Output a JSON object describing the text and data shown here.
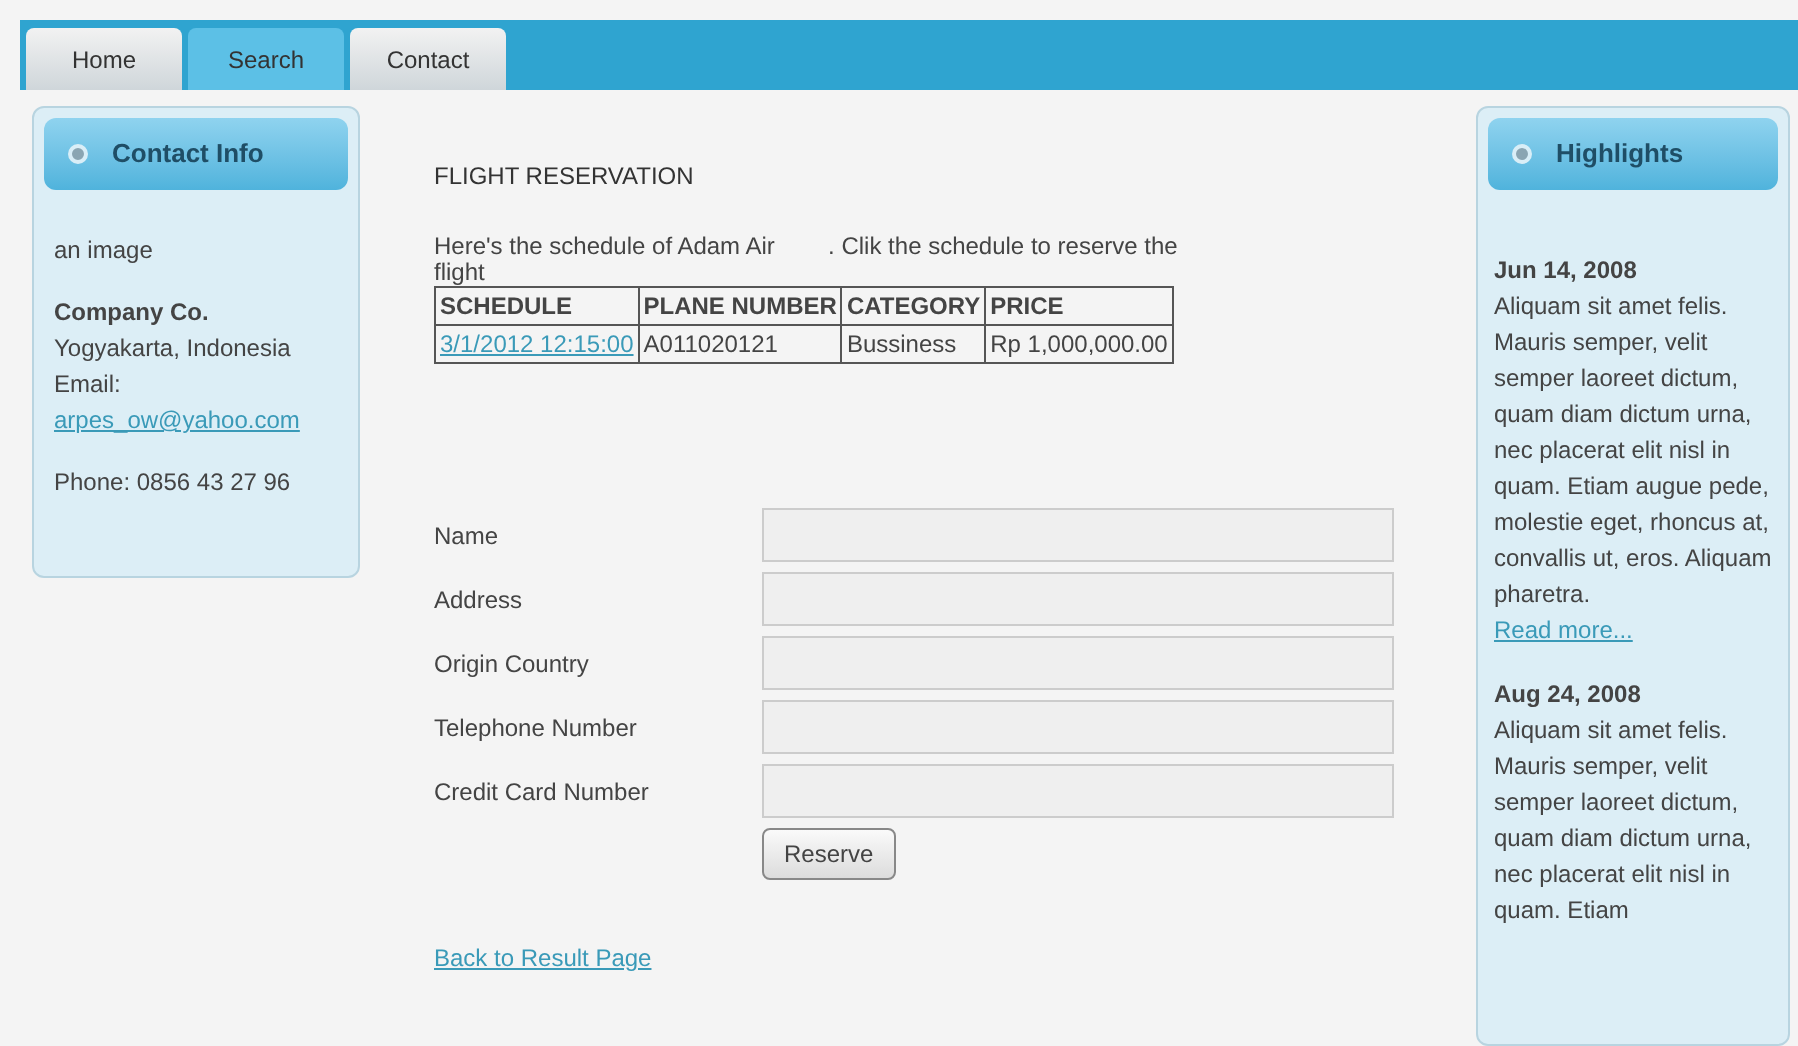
{
  "tabs": [
    {
      "label": "Home",
      "selected": false
    },
    {
      "label": "Search",
      "selected": true
    },
    {
      "label": "Contact",
      "selected": false
    }
  ],
  "contact_panel": {
    "title": "Contact Info",
    "image_alt": "an image",
    "company": "Company Co.",
    "address": "Yogyakarta, Indonesia",
    "email_label": "Email:",
    "email": "arpes_ow@yahoo.com",
    "phone": "Phone: 0856 43 27 96"
  },
  "main": {
    "title": "FLIGHT RESERVATION",
    "intro": "Here's the schedule of Adam Air        . Clik the schedule to reserve the flight",
    "table": {
      "columns": [
        "SCHEDULE",
        "PLANE NUMBER",
        "CATEGORY",
        "PRICE"
      ],
      "rows": [
        [
          "3/1/2012 12:15:00",
          "A011020121",
          "Bussiness",
          "Rp 1,000,000.00"
        ]
      ]
    },
    "form": {
      "fields": [
        {
          "label": "Name"
        },
        {
          "label": "Address"
        },
        {
          "label": "Origin Country"
        },
        {
          "label": "Telephone Number"
        },
        {
          "label": "Credit Card Number"
        }
      ],
      "submit": "Reserve"
    },
    "back_link": "Back to Result Page"
  },
  "highlights_panel": {
    "title": "Highlights",
    "items": [
      {
        "date": "Jun 14, 2008",
        "text": "Aliquam sit amet felis. Mauris semper, velit semper laoreet dictum, quam diam dictum urna, nec placerat elit nisl in quam. Etiam augue pede, molestie eget, rhoncus at, convallis ut, eros. Aliquam pharetra.",
        "link": "Read more..."
      },
      {
        "date": "Aug 24, 2008",
        "text": "Aliquam sit amet felis. Mauris semper, velit semper laoreet dictum, quam diam dictum urna, nec placerat elit nisl in quam. Etiam"
      }
    ]
  }
}
